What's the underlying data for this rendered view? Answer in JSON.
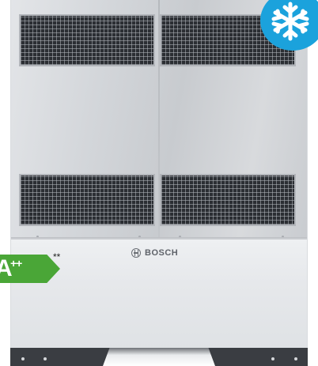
{
  "product": {
    "brand_name": "BOSCH",
    "energy_class": "A",
    "energy_class_suffix": "++",
    "energy_footnote_marker": "**"
  },
  "badge": {
    "icon": "snowflake-icon",
    "color": "#1ba2dc"
  },
  "colors": {
    "energy_label": "#4aa637",
    "housing": "#d9dcdf",
    "grille": "#2b2e33"
  }
}
